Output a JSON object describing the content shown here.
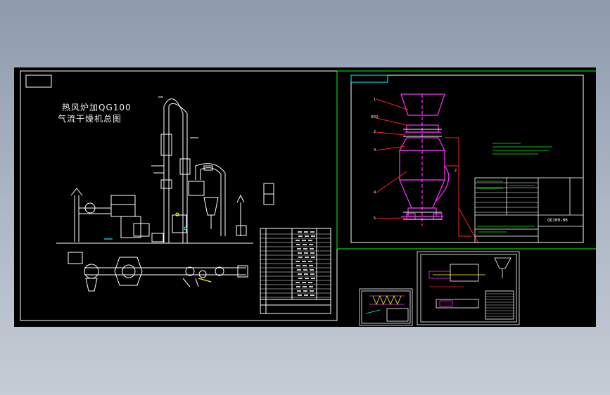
{
  "drawing": {
    "title_line1": "热风炉加QG100",
    "title_line2": "气流干燥机总图",
    "part_code": "QG100-06"
  },
  "colors": {
    "background": "#000000",
    "white_lines": "#ffffff",
    "green_frame": "#00ff00",
    "red_leaders": "#ff2020",
    "magenta_body": "#ff30ff",
    "cyan": "#00ffff",
    "yellow": "#ffff00"
  }
}
